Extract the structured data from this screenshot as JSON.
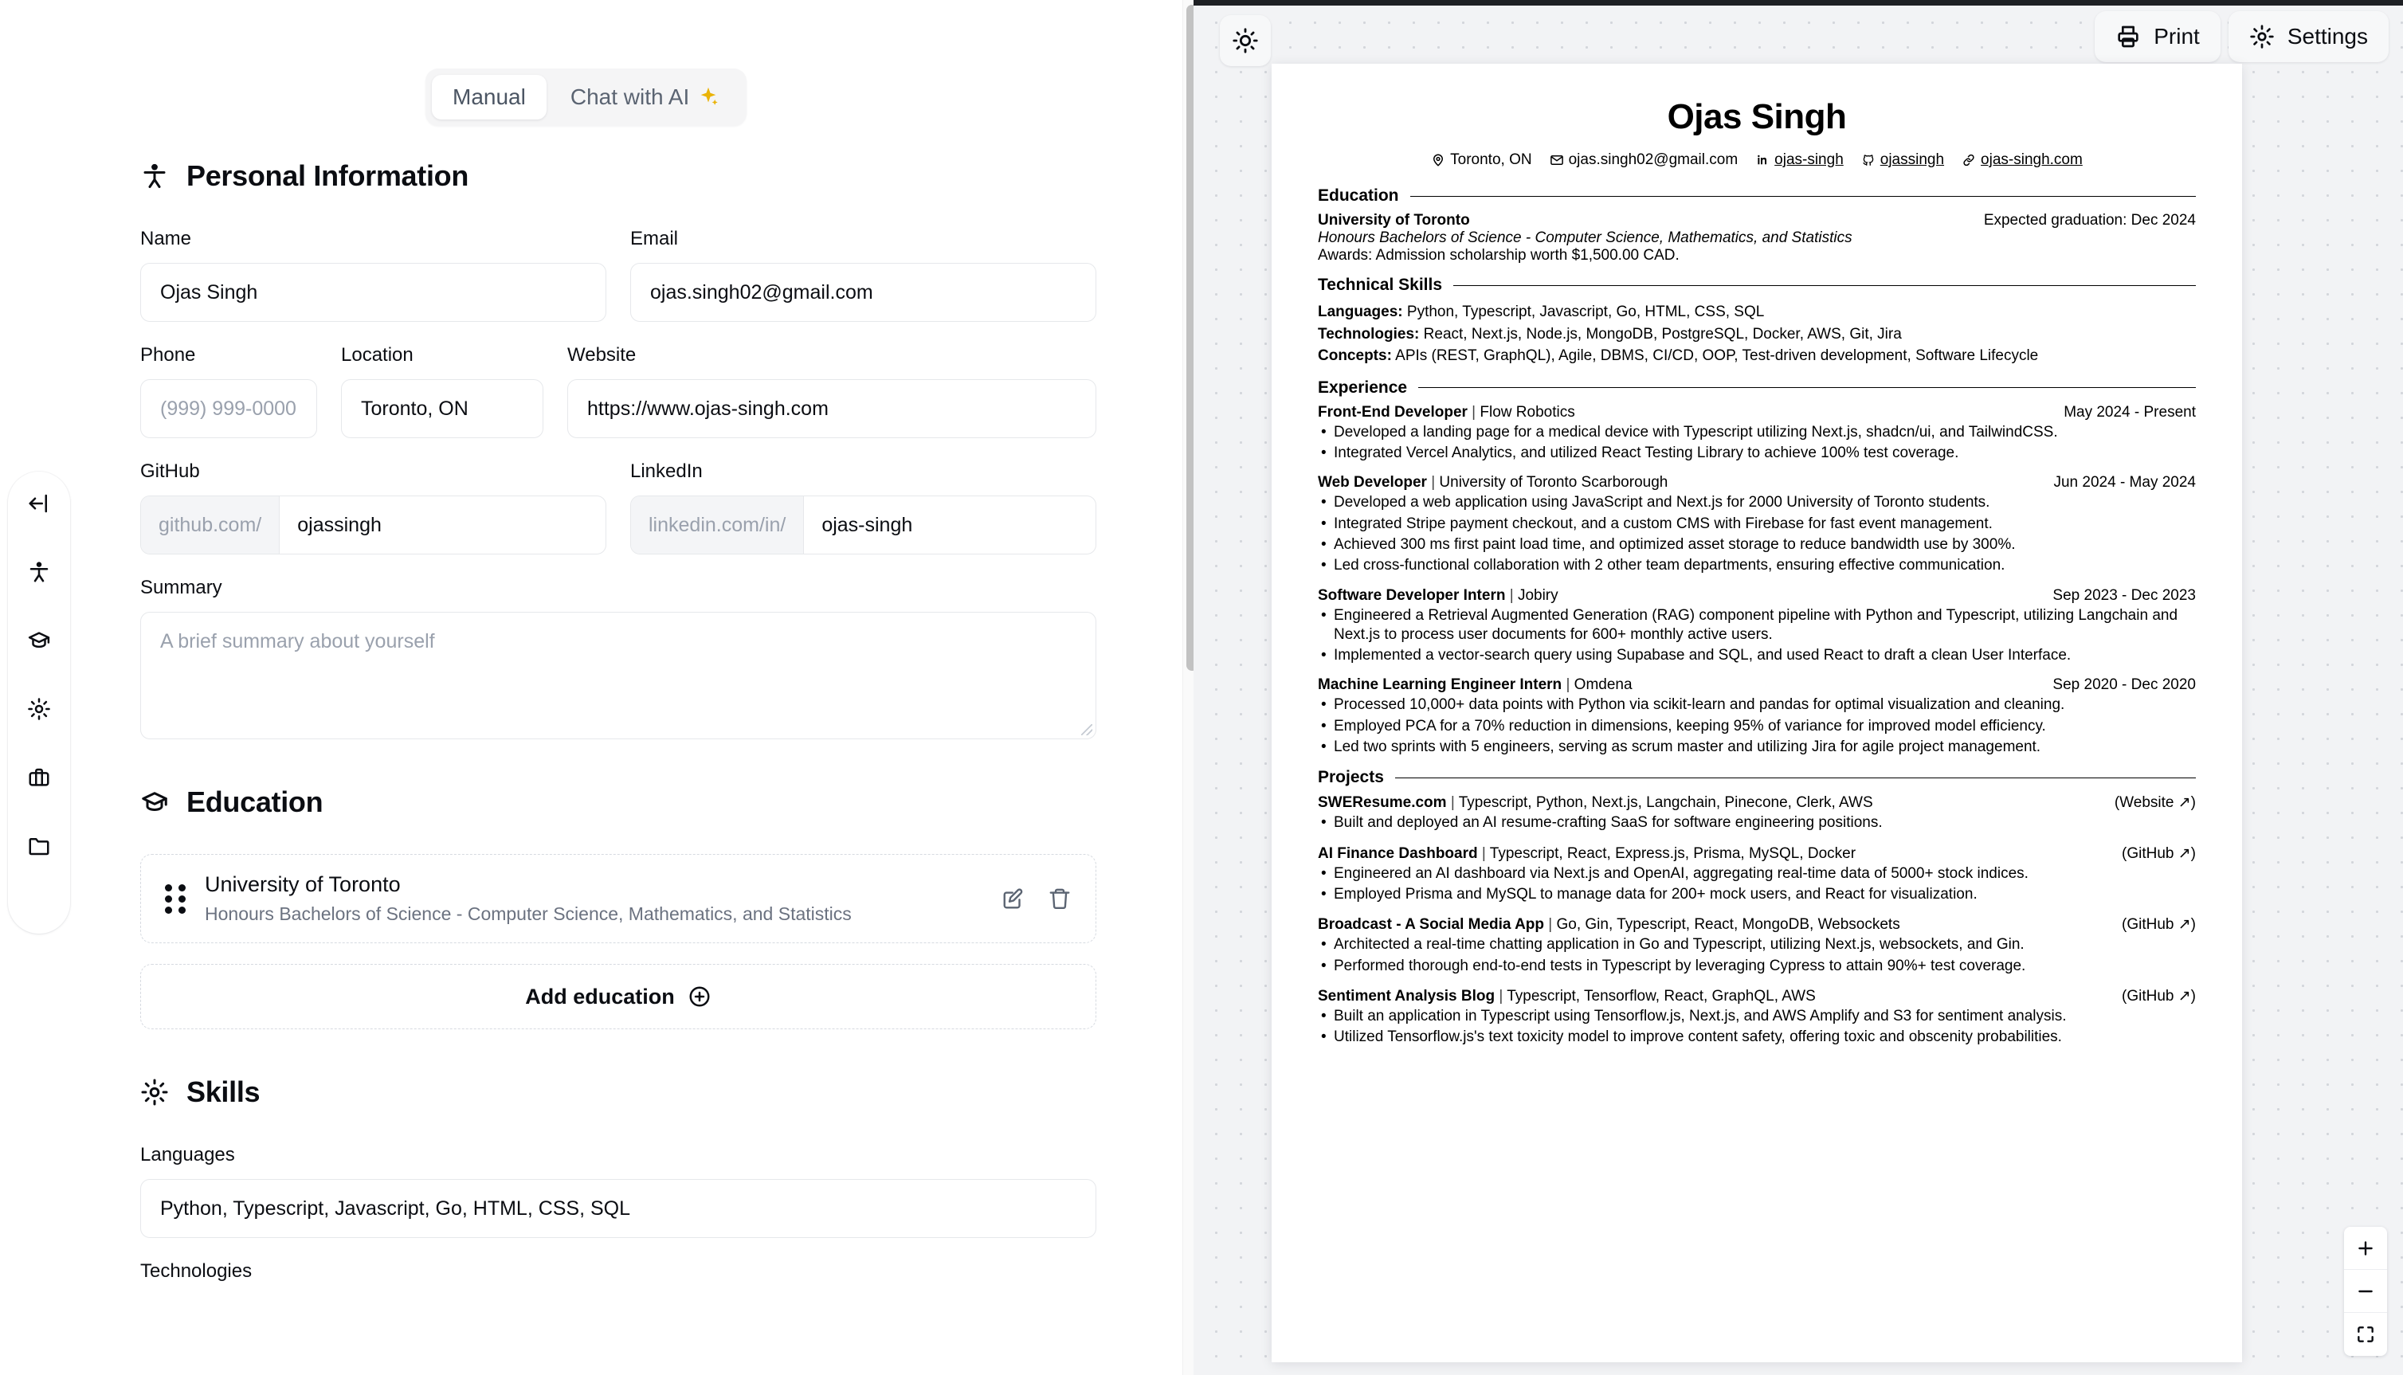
{
  "mode_toggle": {
    "manual_label": "Manual",
    "ai_label": "Chat with AI",
    "sparkle_color": "#eab308"
  },
  "rail": {
    "items": [
      {
        "icon": "collapse-panel-icon",
        "name": "collapse-sidebar"
      },
      {
        "icon": "person-icon",
        "name": "personal-information"
      },
      {
        "icon": "graduation-cap-icon",
        "name": "education"
      },
      {
        "icon": "gear-icon",
        "name": "skills"
      },
      {
        "icon": "briefcase-icon",
        "name": "experience"
      },
      {
        "icon": "folder-icon",
        "name": "projects"
      }
    ]
  },
  "editor": {
    "personal": {
      "heading": "Personal Information",
      "name_label": "Name",
      "name_value": "Ojas Singh",
      "email_label": "Email",
      "email_value": "ojas.singh02@gmail.com",
      "phone_label": "Phone",
      "phone_placeholder": "(999) 999-0000",
      "location_label": "Location",
      "location_value": "Toronto, ON",
      "website_label": "Website",
      "website_value": "https://www.ojas-singh.com",
      "github_label": "GitHub",
      "github_prefix": "github.com/",
      "github_value": "ojassingh",
      "linkedin_label": "LinkedIn",
      "linkedin_prefix": "linkedin.com/in/",
      "linkedin_value": "ojas-singh",
      "summary_label": "Summary",
      "summary_placeholder": "A brief summary about yourself"
    },
    "education": {
      "heading": "Education",
      "items": [
        {
          "title": "University of Toronto",
          "subtitle": "Honours Bachelors of Science - Computer Science, Mathematics, and Statistics"
        }
      ],
      "add_label": "Add education"
    },
    "skills": {
      "heading": "Skills",
      "languages_label": "Languages",
      "languages_value": "Python, Typescript, Javascript, Go, HTML, CSS, SQL",
      "technologies_label": "Technologies"
    }
  },
  "preview": {
    "print_label": "Print",
    "settings_label": "Settings",
    "zoom_in": "+",
    "zoom_out": "−"
  },
  "resume": {
    "name": "Ojas Singh",
    "contacts": [
      {
        "icon": "map-pin-icon",
        "text": "Toronto, ON",
        "link": false
      },
      {
        "icon": "mail-icon",
        "text": "ojas.singh02@gmail.com",
        "link": false
      },
      {
        "icon": "linkedin-icon",
        "text": "ojas-singh",
        "link": true
      },
      {
        "icon": "github-icon",
        "text": "ojassingh",
        "link": true
      },
      {
        "icon": "link-icon",
        "text": "ojas-singh.com",
        "link": true
      }
    ],
    "sections": {
      "education_title": "Education",
      "skills_title": "Technical Skills",
      "experience_title": "Experience",
      "projects_title": "Projects"
    },
    "education": [
      {
        "school": "University of Toronto",
        "date": "Expected graduation: Dec 2024",
        "degree": "Honours Bachelors of Science - Computer Science, Mathematics, and Statistics",
        "awards": "Awards: Admission scholarship worth $1,500.00 CAD."
      }
    ],
    "skills": [
      {
        "label": "Languages:",
        "value": "Python, Typescript, Javascript, Go, HTML, CSS, SQL"
      },
      {
        "label": "Technologies:",
        "value": "React, Next.js, Node.js, MongoDB, PostgreSQL, Docker, AWS, Git, Jira"
      },
      {
        "label": "Concepts:",
        "value": "APIs (REST, GraphQL), Agile, DBMS, CI/CD, OOP, Test-driven development, Software Lifecycle"
      }
    ],
    "experience": [
      {
        "role": "Front-End Developer",
        "company": "Flow Robotics",
        "date": "May 2024 - Present",
        "bullets": [
          "Developed a landing page for a medical device with Typescript utilizing Next.js, shadcn/ui, and TailwindCSS.",
          "Integrated Vercel Analytics, and utilized React Testing Library to achieve 100% test coverage."
        ]
      },
      {
        "role": "Web Developer",
        "company": "University of Toronto Scarborough",
        "date": "Jun 2024 - May 2024",
        "bullets": [
          "Developed a web application using JavaScript and Next.js for 2000 University of Toronto students.",
          "Integrated Stripe payment checkout, and a custom CMS with Firebase for fast event management.",
          "Achieved 300 ms first paint load time, and optimized asset storage to reduce bandwidth use by 300%.",
          "Led cross-functional collaboration with 2 other team departments, ensuring effective communication."
        ]
      },
      {
        "role": "Software Developer Intern",
        "company": "Jobiry",
        "date": "Sep 2023 - Dec 2023",
        "bullets": [
          "Engineered a Retrieval Augmented Generation (RAG) component pipeline with Python and Typescript, utilizing Langchain and Next.js to process user documents for 600+ monthly active users.",
          "Implemented a vector-search query using Supabase and SQL, and used React to draft a clean User Interface."
        ]
      },
      {
        "role": "Machine Learning Engineer Intern",
        "company": "Omdena",
        "date": "Sep 2020 - Dec 2020",
        "bullets": [
          "Processed 10,000+ data points with Python via scikit-learn and pandas for optimal visualization and cleaning.",
          "Employed PCA for a 70% reduction in dimensions, keeping 95% of variance for improved model efficiency.",
          "Led two sprints with 5 engineers, serving as scrum master and utilizing Jira for agile project management."
        ]
      }
    ],
    "projects": [
      {
        "title": "SWEResume.com",
        "stack": "Typescript, Python, Next.js, Langchain, Pinecone, Clerk, AWS",
        "link_label": "(Website ↗)",
        "bullets": [
          "Built and deployed an AI resume-crafting SaaS for software engineering positions."
        ]
      },
      {
        "title": "AI Finance Dashboard",
        "stack": "Typescript, React, Express.js, Prisma, MySQL, Docker",
        "link_label": "(GitHub ↗)",
        "bullets": [
          "Engineered an AI dashboard via Next.js and OpenAI, aggregating real-time data of 5000+ stock indices.",
          "Employed Prisma and MySQL to manage data for 200+ mock users, and React for visualization."
        ]
      },
      {
        "title": "Broadcast - A Social Media App",
        "stack": "Go, Gin, Typescript, React, MongoDB, Websockets",
        "link_label": "(GitHub ↗)",
        "bullets": [
          "Architected a real-time chatting application in Go and Typescript, utilizing Next.js, websockets, and Gin.",
          "Performed thorough end-to-end tests in Typescript by leveraging Cypress to attain 90%+ test coverage."
        ]
      },
      {
        "title": "Sentiment Analysis Blog",
        "stack": "Typescript, Tensorflow, React, GraphQL, AWS",
        "link_label": "(GitHub ↗)",
        "bullets": [
          "Built an application in Typescript using Tensorflow.js, Next.js, and AWS Amplify and S3 for sentiment analysis.",
          "Utilized Tensorflow.js's text toxicity model to improve content safety, offering toxic and obscenity probabilities."
        ]
      }
    ]
  }
}
